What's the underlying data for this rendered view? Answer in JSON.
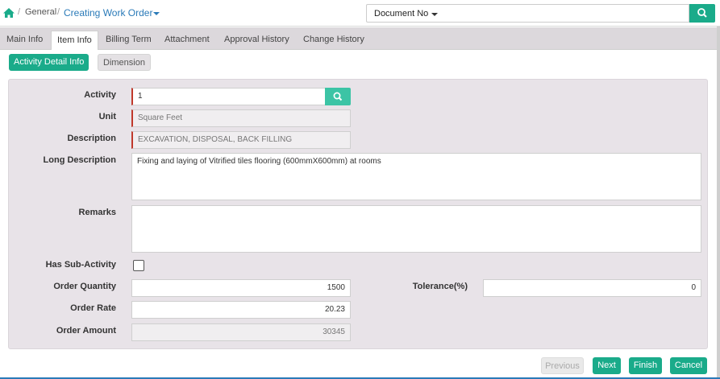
{
  "breadcrumb": {
    "sep": "/",
    "section": "General",
    "title": "Creating Work Order"
  },
  "search": {
    "selector_label": "Document No",
    "value": ""
  },
  "tabs": [
    {
      "label": "Main Info",
      "active": false
    },
    {
      "label": "Item Info",
      "active": true
    },
    {
      "label": "Billing Term",
      "active": false
    },
    {
      "label": "Attachment",
      "active": false
    },
    {
      "label": "Approval History",
      "active": false
    },
    {
      "label": "Change History",
      "active": false
    }
  ],
  "subtabs": [
    {
      "label": "Activity Detail Info",
      "active": true
    },
    {
      "label": "Dimension",
      "active": false
    }
  ],
  "form": {
    "activity_label": "Activity",
    "activity_value": "1",
    "unit_label": "Unit",
    "unit_value": "Square Feet",
    "description_label": "Description",
    "description_value": "EXCAVATION, DISPOSAL, BACK FILLING",
    "long_description_label": "Long Description",
    "long_description_value": "Fixing and laying of  Vitrified tiles flooring (600mmX600mm) at rooms",
    "remarks_label": "Remarks",
    "remarks_value": "",
    "has_sub_activity_label": "Has Sub-Activity",
    "has_sub_activity_checked": false,
    "order_quantity_label": "Order Quantity",
    "order_quantity_value": "1500",
    "order_rate_label": "Order Rate",
    "order_rate_value": "20.23",
    "order_amount_label": "Order Amount",
    "order_amount_value": "30345",
    "tolerance_label": "Tolerance(%)",
    "tolerance_value": "0"
  },
  "footer": {
    "previous_label": "Previous",
    "next_label": "Next",
    "finish_label": "Finish",
    "cancel_label": "Cancel"
  },
  "colors": {
    "accent": "#1aab8a",
    "link": "#2a7ab8",
    "required": "#c0392b",
    "panel": "#e8e3e8"
  },
  "icons": {
    "home": "home-icon",
    "search": "search-icon",
    "caret": "caret-down-icon"
  }
}
